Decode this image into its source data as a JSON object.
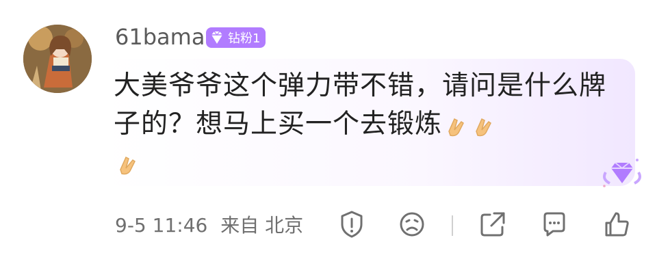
{
  "comment": {
    "username": "61bama",
    "badge_label": "钻粉1",
    "text": "大美爷爷这个弹力带不错，请问是什么牌子的？想马上买一个去锻炼",
    "emoji_count": 3,
    "timestamp": "9-5 11:46",
    "location_prefix": "来自",
    "location": "北京"
  },
  "actions": {
    "icons": [
      "report-icon",
      "dislike-icon",
      "share-icon",
      "comment-icon",
      "like-icon"
    ]
  },
  "colors": {
    "badge_bg": "#b17cff",
    "bubble_end": "#f1e7ff",
    "text_main": "#222222",
    "text_meta": "#6f6f6f"
  }
}
